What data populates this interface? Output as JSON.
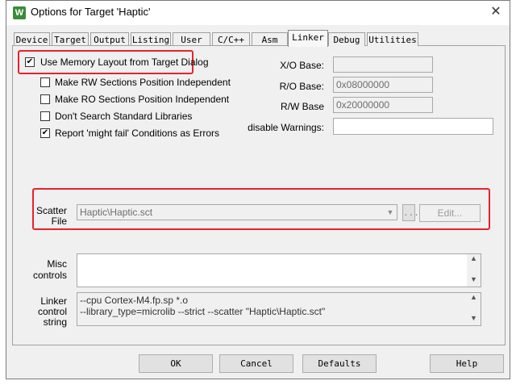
{
  "window": {
    "title": "Options for Target 'Haptic'",
    "app_icon_letter": "W",
    "close_glyph": "✕"
  },
  "tabs": [
    {
      "label": "Device"
    },
    {
      "label": "Target"
    },
    {
      "label": "Output"
    },
    {
      "label": "Listing"
    },
    {
      "label": "User"
    },
    {
      "label": "C/C++"
    },
    {
      "label": "Asm"
    },
    {
      "label": "Linker"
    },
    {
      "label": "Debug"
    },
    {
      "label": "Utilities"
    }
  ],
  "active_tab": "Linker",
  "options": {
    "use_memory_layout": {
      "label": "Use Memory Layout from Target Dialog",
      "checked": true
    },
    "rw_pos_indep": {
      "label": "Make RW Sections Position Independent",
      "checked": false
    },
    "ro_pos_indep": {
      "label": "Make RO Sections Position Independent",
      "checked": false
    },
    "dont_search_libs": {
      "label": "Don't Search Standard Libraries",
      "checked": false
    },
    "might_fail_errors": {
      "label": "Report 'might fail' Conditions as Errors",
      "checked": true
    }
  },
  "bases": {
    "xo_label": "X/O Base:",
    "xo_value": "",
    "ro_label": "R/O Base:",
    "ro_value": "0x08000000",
    "rw_label": "R/W Base",
    "rw_value": "0x20000000",
    "warnings_label": "disable Warnings:",
    "warnings_value": ""
  },
  "scatter": {
    "label_line1": "Scatter",
    "label_line2": "File",
    "value": "Haptic\\Haptic.sct",
    "browse_label": "...",
    "edit_label": "Edit..."
  },
  "misc": {
    "label_line1": "Misc",
    "label_line2": "controls",
    "value": ""
  },
  "linker_string": {
    "label_line1": "Linker",
    "label_line2": "control",
    "label_line3": "string",
    "line1": "--cpu Cortex-M4.fp.sp *.o",
    "line2": "--library_type=microlib --strict --scatter \"Haptic\\Haptic.sct\""
  },
  "buttons": {
    "ok": "OK",
    "cancel": "Cancel",
    "defaults": "Defaults",
    "help": "Help"
  },
  "colors": {
    "highlight": "#e8232a",
    "dialog_bg": "#f0f0f0"
  }
}
